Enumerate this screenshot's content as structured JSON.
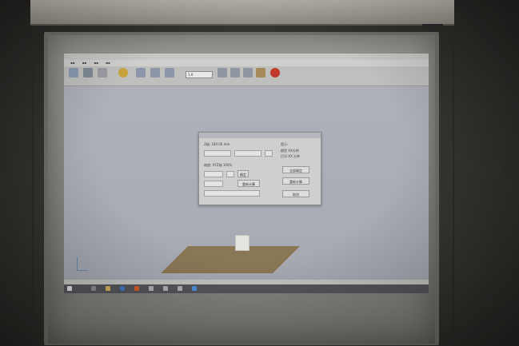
{
  "scene": {
    "description_colors": {
      "wall": "#3a3834",
      "projection": "#9c9b96",
      "build_plate": "#8a7756",
      "toolbar_accent_red": "#c0392b"
    }
  },
  "app": {
    "view_select_value": "1.0"
  },
  "dialog": {
    "fields_row1_label": "Z轴: 180.00 mm",
    "hint_lines": [
      "提示:",
      "模型 XX分钟",
      "打印 XX 分钟"
    ],
    "row2_label": "缩放: XYZ轴 100%",
    "buttons": [
      "全部确定",
      "重新计算",
      "取消"
    ],
    "small_btn": "确定"
  },
  "icons": {
    "toolbar": [
      "open-icon",
      "save-icon",
      "settings-icon",
      "print-icon",
      "move-icon",
      "rotate-icon",
      "scale-icon",
      "support-icon",
      "slice-icon",
      "stop-icon"
    ],
    "taskbar": [
      "windows-icon",
      "search-icon",
      "folder-icon",
      "browser-icon",
      "app-icon"
    ]
  }
}
